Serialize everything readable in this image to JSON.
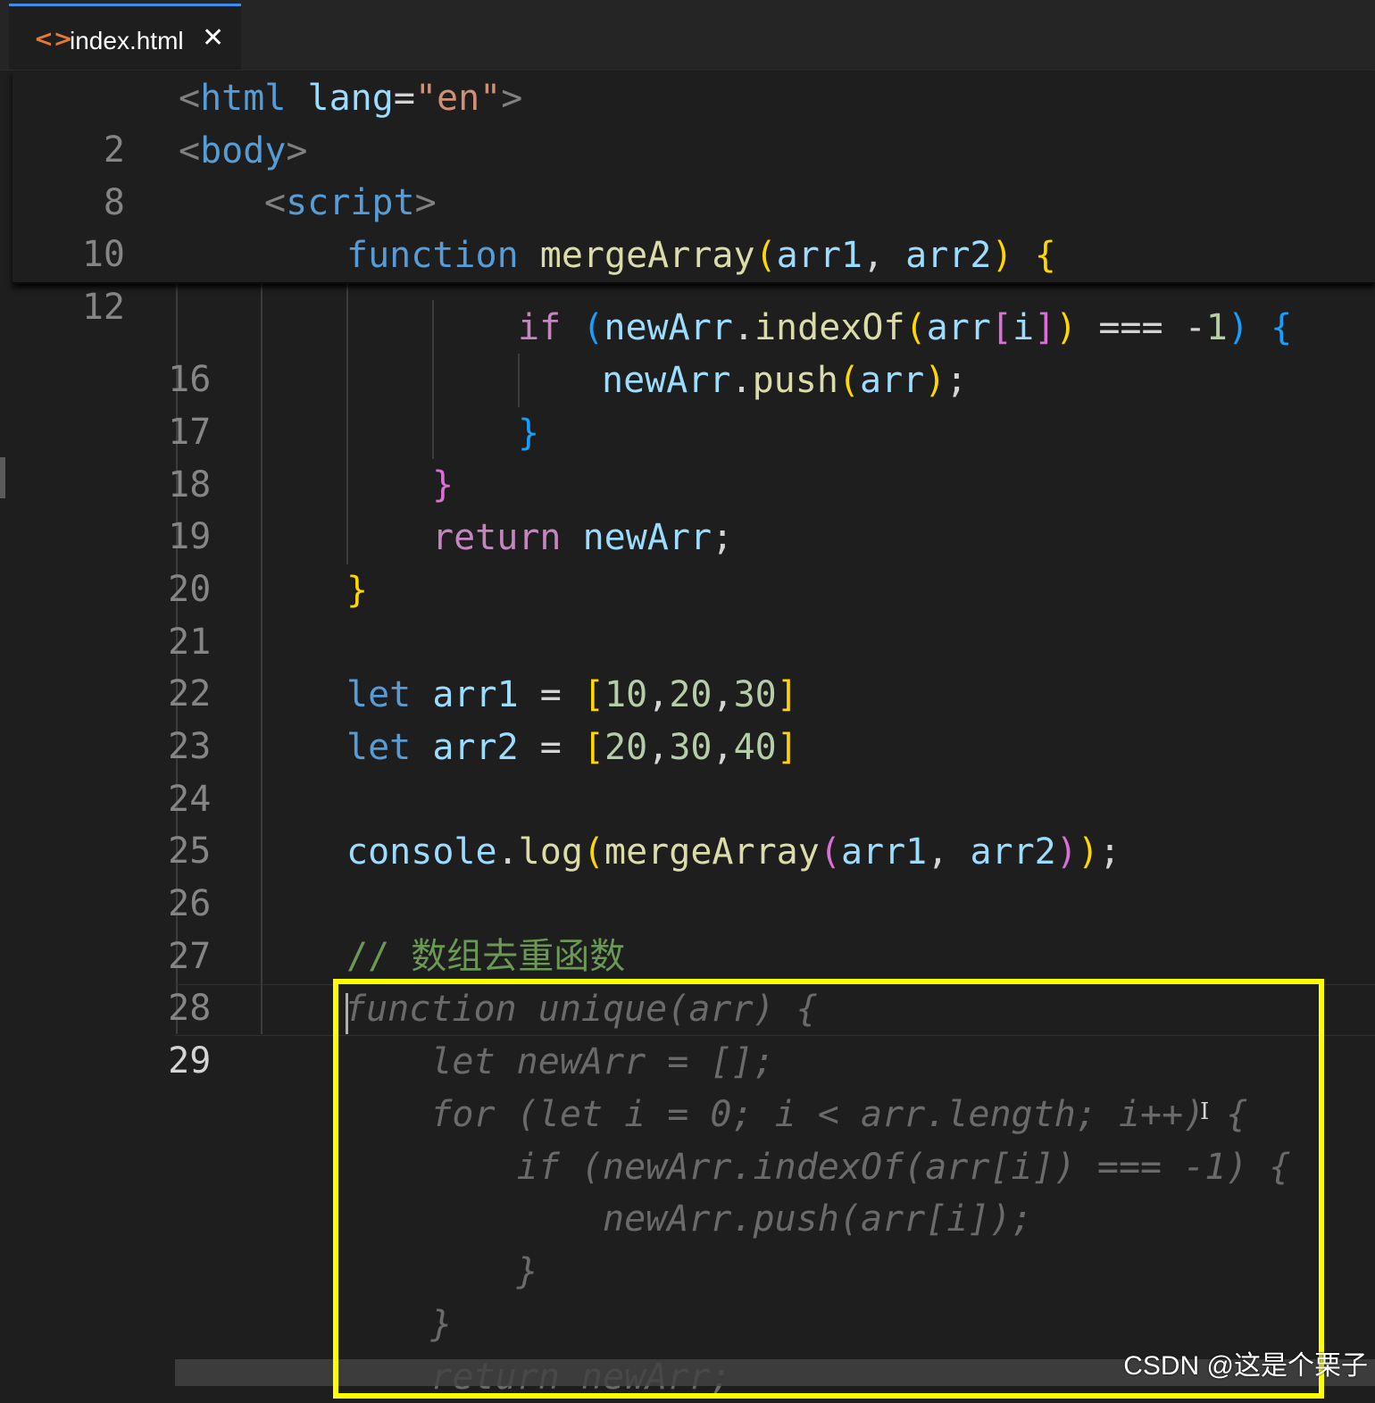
{
  "tab": {
    "icon": "html-file-icon",
    "title": "index.html",
    "close_glyph": "✕"
  },
  "sticky": {
    "line_numbers": [
      "2",
      "8",
      "10",
      "12"
    ]
  },
  "code": {
    "line_numbers": [
      "16",
      "17",
      "18",
      "19",
      "20",
      "21",
      "22",
      "23",
      "24",
      "25",
      "26",
      "27",
      "28",
      "29"
    ],
    "current_line": "29",
    "comment": "// 数组去重函数"
  },
  "peek": {
    "lines": [
      "function unique(arr) {",
      "    let newArr = [];",
      "    for (let i = 0; i < arr.length; i++) {",
      "        if (newArr.indexOf(arr[i]) === -1) {",
      "            newArr.push(arr[i]);",
      "        }",
      "    }",
      "    return newArr;"
    ]
  },
  "highlight_color": "#ffff00",
  "watermark": "CSDN @这是个栗子"
}
